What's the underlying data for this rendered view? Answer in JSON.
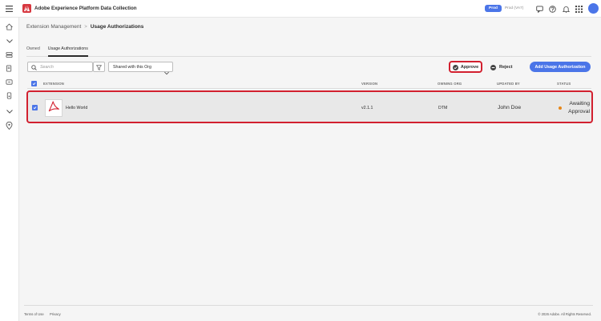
{
  "header": {
    "app_title": "Adobe Experience Platform Data Collection",
    "env_active": "Prod",
    "env_other": "Prod (VA7)",
    "icons": [
      "menu-icon",
      "adobe-logo-icon",
      "feedback-icon",
      "help-icon",
      "bell-icon",
      "apps-grid-icon",
      "user-avatar"
    ]
  },
  "rail": {
    "icons": [
      "home-icon",
      "chevron-down-icon",
      "data-source-icon",
      "schema-icon",
      "destinations-icon",
      "tags-icon",
      "chevron-down-icon",
      "location-icon"
    ]
  },
  "breadcrumb": {
    "parent": "Extension Management",
    "separator": ">",
    "current": "Usage Authorizations"
  },
  "tabs": [
    {
      "label": "Owned",
      "active": false
    },
    {
      "label": "Usage Authorizations",
      "active": true
    }
  ],
  "toolbar": {
    "search_placeholder": "Search",
    "filter_value": "Shared with this Org",
    "approve_label": "Approve",
    "reject_label": "Reject",
    "add_label": "Add Usage Authorization"
  },
  "table": {
    "headers": {
      "extension": "EXTENSION",
      "version": "VERSION",
      "owning_org": "OWNING ORG",
      "updated_by": "UPDATED BY",
      "status": "STATUS"
    },
    "rows": [
      {
        "selected": true,
        "extension": "Hello World",
        "version": "v2.1.1",
        "owning_org": "DTM",
        "updated_by": "John Doe",
        "status": "Awaiting Approval",
        "status_color": "#e68619"
      }
    ]
  },
  "footer": {
    "terms": "Terms of Use",
    "privacy": "Privacy",
    "copyright": "© 2026 Adobe. All Rights Reserved."
  },
  "colors": {
    "accent": "#4b75e8",
    "highlight": "#d2202f",
    "brand": "#d7373f"
  }
}
